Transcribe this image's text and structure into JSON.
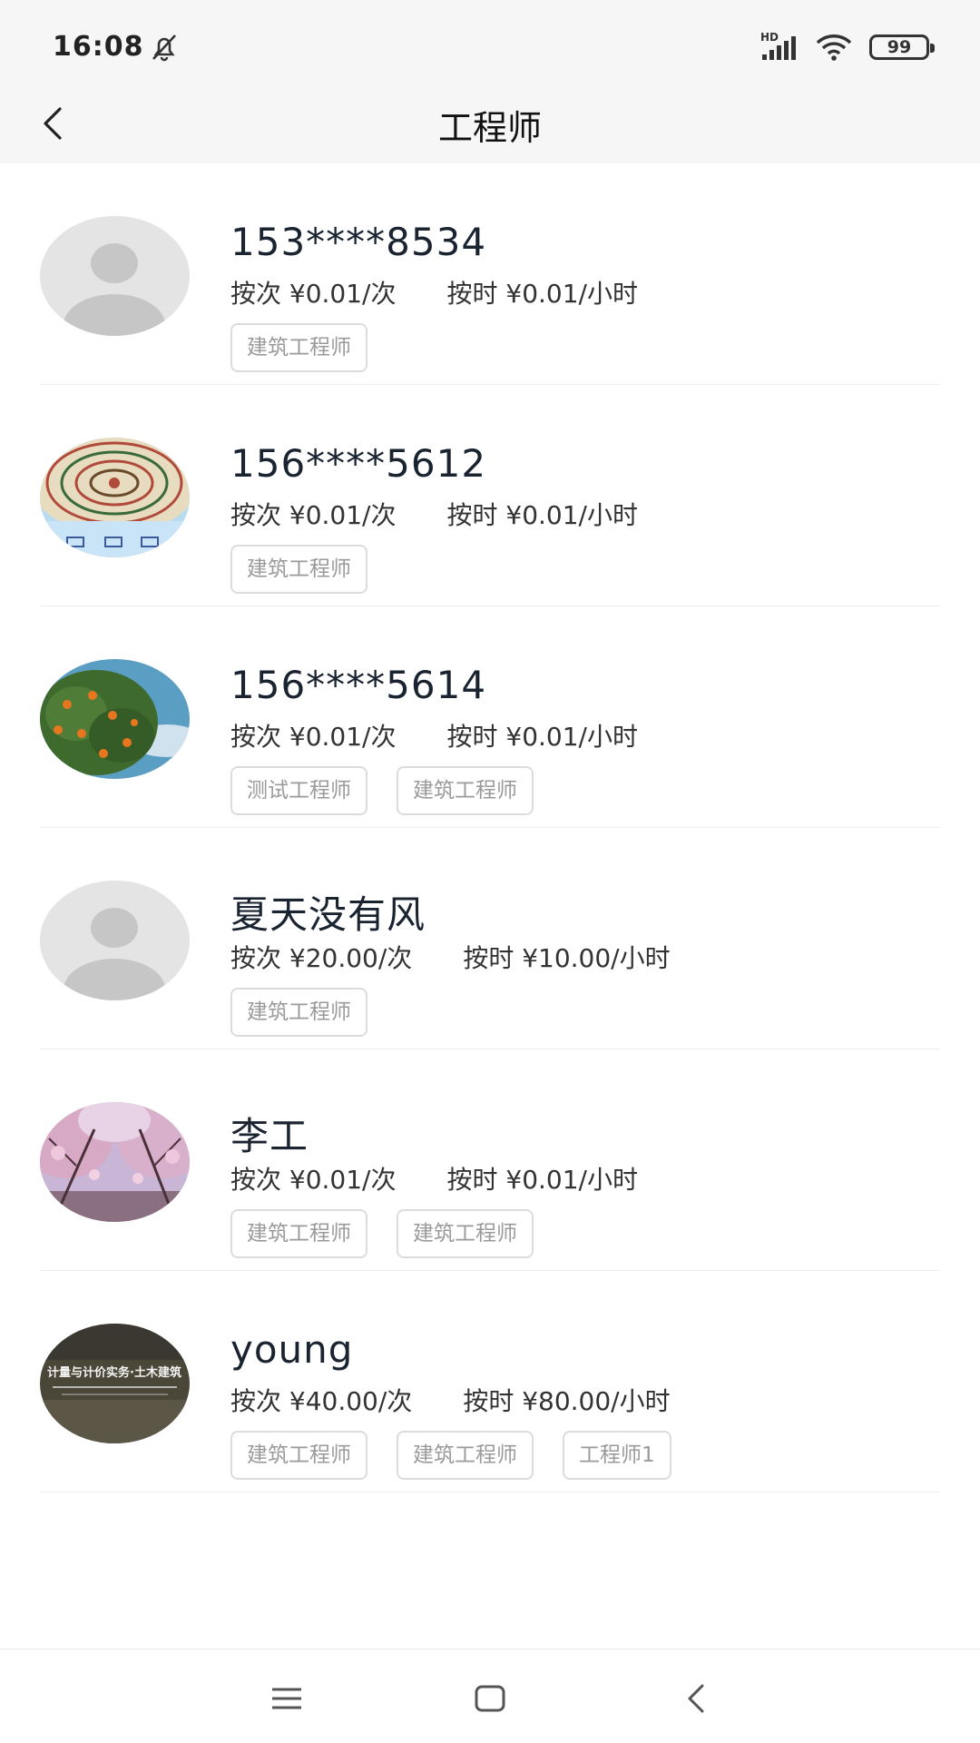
{
  "status_bar": {
    "time": "16:08",
    "mute_icon": "bell-off-icon",
    "signal_label": "HD",
    "wifi_icon": "wifi-icon",
    "battery": "99"
  },
  "app_bar": {
    "title": "工程师",
    "back_icon": "chevron-left-icon"
  },
  "engineers": [
    {
      "name": "153****8534",
      "price_per_time": "按次 ¥0.01/次",
      "price_per_hour": "按时 ¥0.01/小时",
      "avatar": "default-avatar",
      "tags": [
        "建筑工程师"
      ]
    },
    {
      "name": "156****5612",
      "price_per_time": "按次 ¥0.01/次",
      "price_per_hour": "按时 ¥0.01/小时",
      "avatar": "compass-chart-photo",
      "tags": [
        "建筑工程师"
      ]
    },
    {
      "name": "156****5614",
      "price_per_time": "按次 ¥0.01/次",
      "price_per_hour": "按时 ¥0.01/小时",
      "avatar": "orange-tree-photo",
      "tags": [
        "测试工程师",
        "建筑工程师"
      ]
    },
    {
      "name": "夏天没有风",
      "price_per_time": "按次 ¥20.00/次",
      "price_per_hour": "按时 ¥10.00/小时",
      "avatar": "default-avatar",
      "tags": [
        "建筑工程师"
      ]
    },
    {
      "name": "李工",
      "price_per_time": "按次 ¥0.01/次",
      "price_per_hour": "按时 ¥0.01/小时",
      "avatar": "cherry-blossom-photo",
      "tags": [
        "建筑工程师",
        "建筑工程师"
      ]
    },
    {
      "name": "young",
      "price_per_time": "按次 ¥40.00/次",
      "price_per_hour": "按时 ¥80.00/小时",
      "avatar": "book-cover-photo",
      "avatar_text": "计量与计价实务·土木建筑",
      "tags": [
        "建筑工程师",
        "建筑工程师",
        "工程师1"
      ]
    }
  ],
  "nav_bar": {
    "menu_icon": "menu-icon",
    "home_icon": "home-square-icon",
    "back_icon": "back-triangle-icon"
  },
  "colors": {
    "header_bg": "#f6f6f6",
    "tag_border": "#dcdcdc",
    "tag_text": "#9a9a9a",
    "divider": "#eeeeee"
  }
}
